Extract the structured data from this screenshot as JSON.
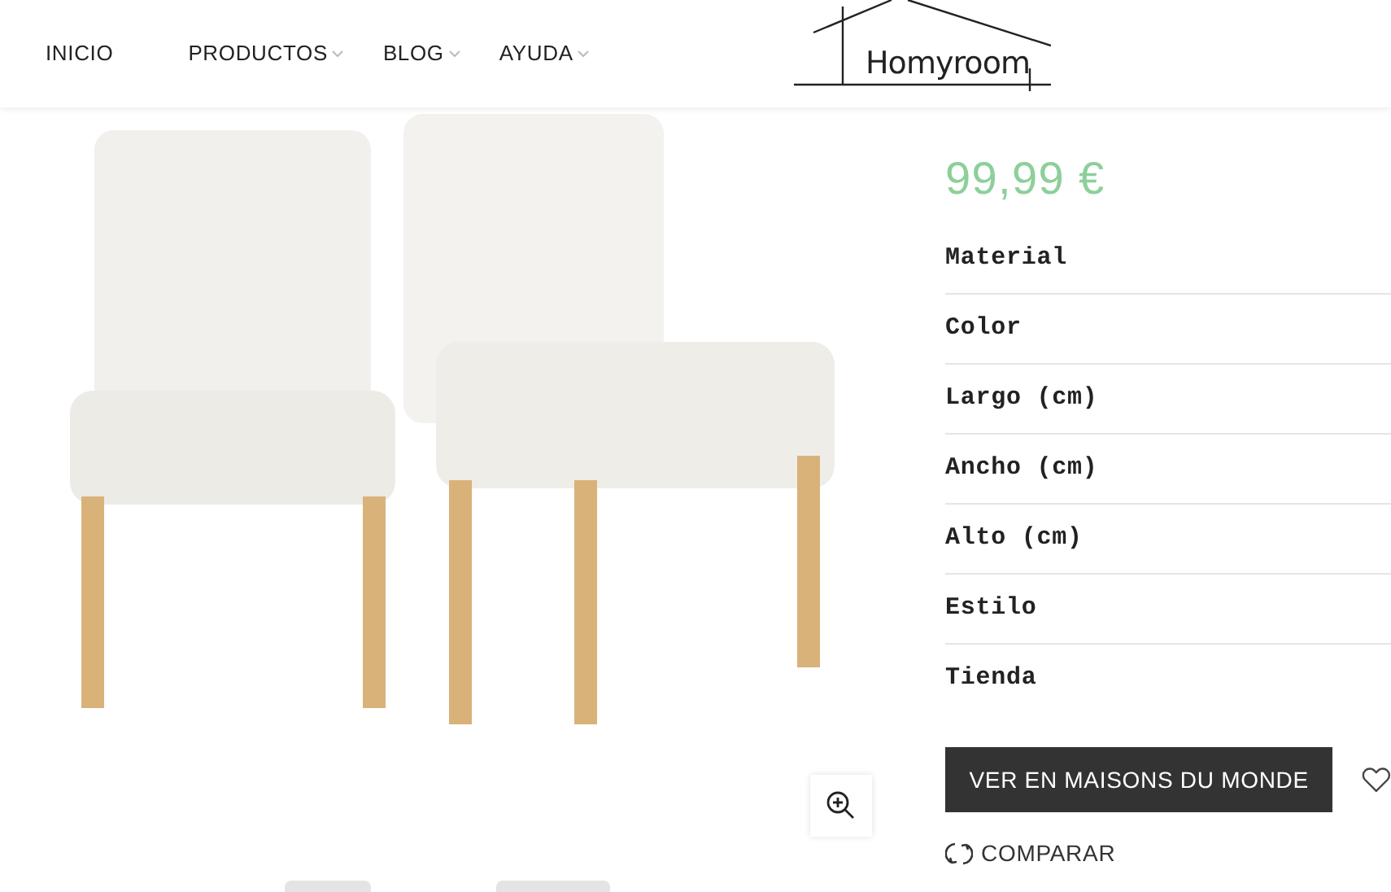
{
  "nav": [
    {
      "label": "INICIO",
      "has_submenu": false
    },
    {
      "label": "PRODUCTOS",
      "has_submenu": true
    },
    {
      "label": "BLOG",
      "has_submenu": true
    },
    {
      "label": "AYUDA",
      "has_submenu": true
    }
  ],
  "logo": {
    "text": "Homyroom"
  },
  "product": {
    "price": "99,99 €",
    "specs": [
      {
        "label": "Material"
      },
      {
        "label": "Color"
      },
      {
        "label": "Largo (cm)"
      },
      {
        "label": "Ancho (cm)"
      },
      {
        "label": "Alto (cm)"
      },
      {
        "label": "Estilo"
      },
      {
        "label": "Tienda"
      }
    ],
    "buy_button": "VER EN MAISONS DU MONDE",
    "compare": "COMPARAR"
  }
}
